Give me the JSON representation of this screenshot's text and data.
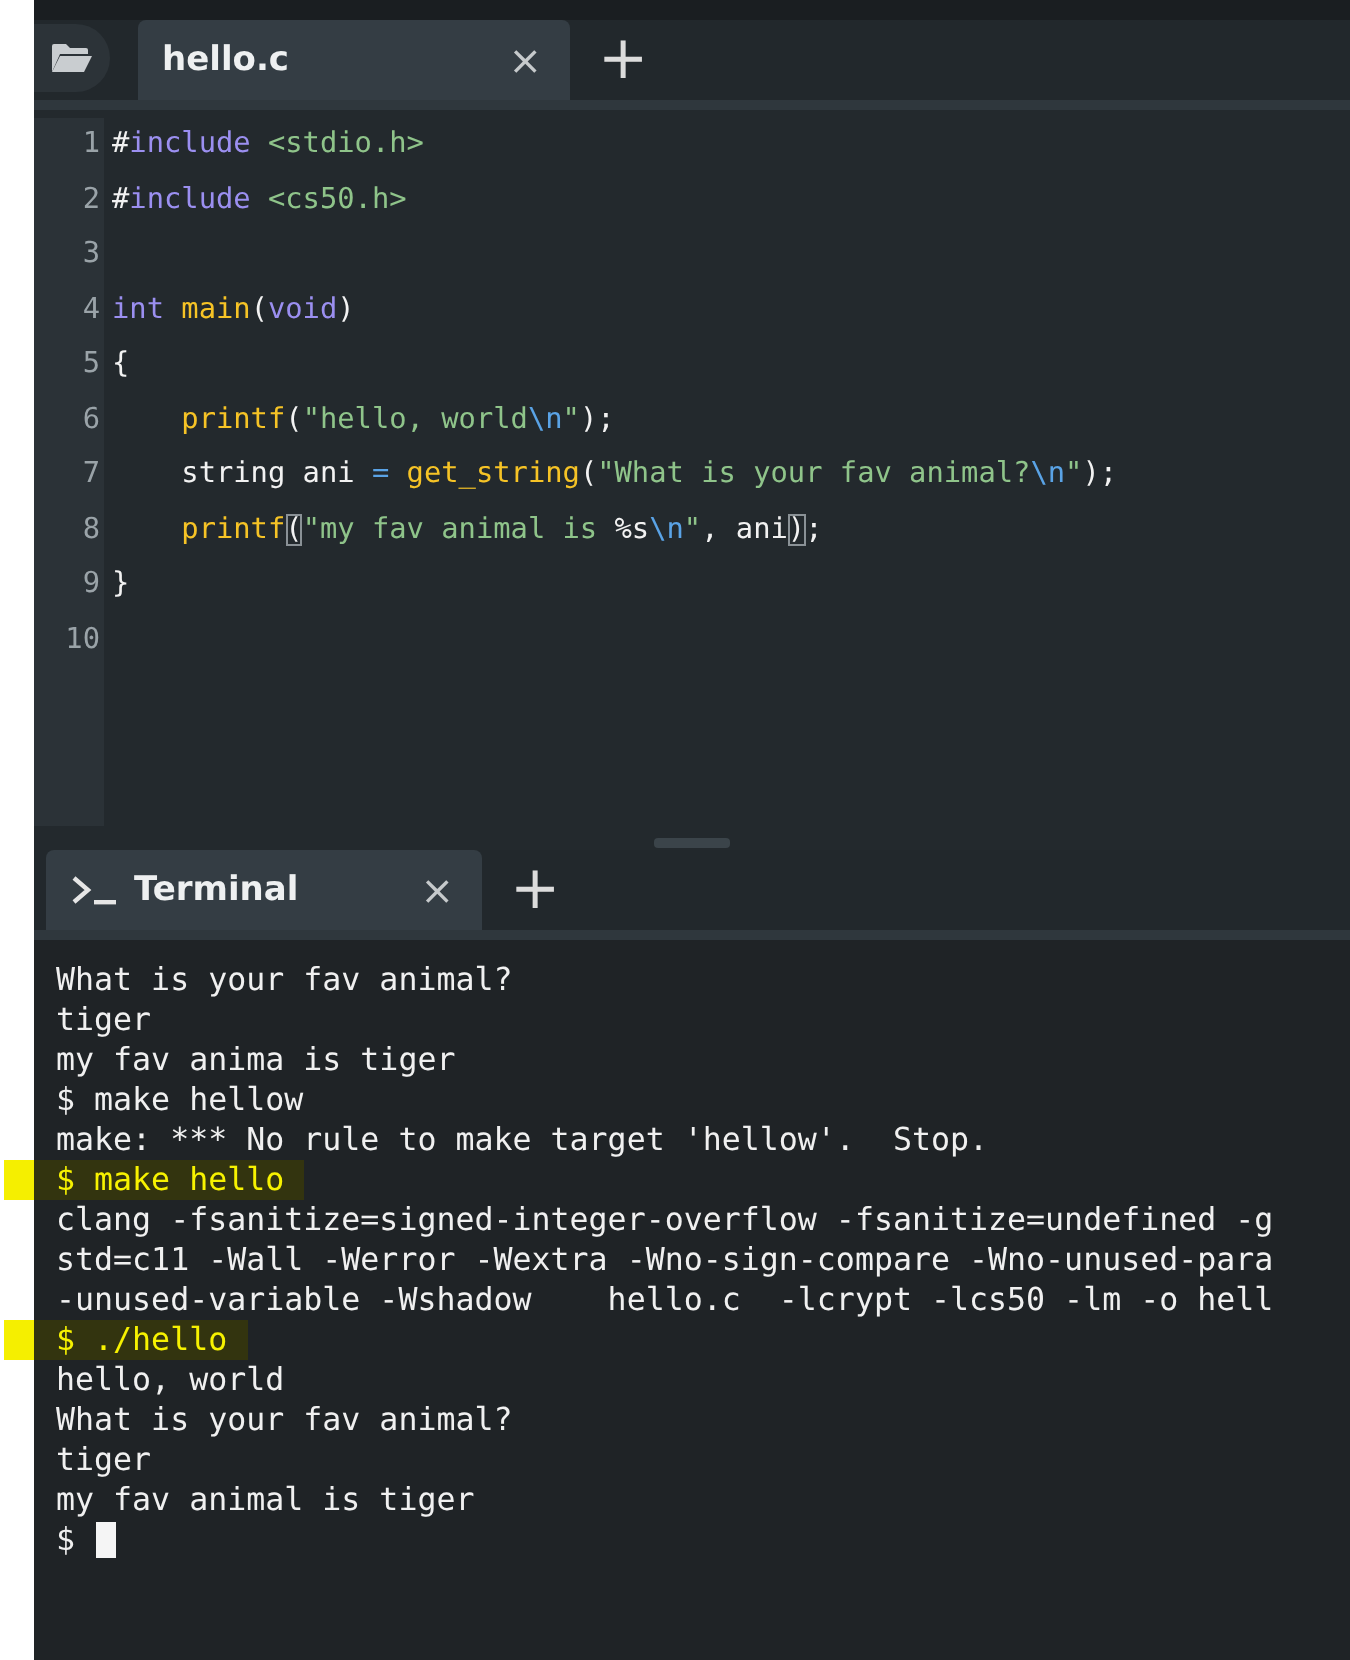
{
  "editor": {
    "tabs": [
      {
        "label": "hello.c",
        "selected": true,
        "close": "×"
      }
    ],
    "add_tab": "+",
    "lines": [
      {
        "number": "1",
        "tokens": [
          {
            "kind": "plain",
            "text": "#"
          },
          {
            "kind": "keyword",
            "text": "include "
          },
          {
            "kind": "string",
            "text": "<stdio.h>"
          }
        ]
      },
      {
        "number": "2",
        "tokens": [
          {
            "kind": "plain",
            "text": "#"
          },
          {
            "kind": "keyword",
            "text": "include "
          },
          {
            "kind": "string",
            "text": "<cs50.h>"
          }
        ]
      },
      {
        "number": "3"
      },
      {
        "number": "4",
        "tokens": [
          {
            "kind": "keyword",
            "text": "int "
          },
          {
            "kind": "func",
            "text": "main"
          },
          {
            "kind": "plain",
            "text": "("
          },
          {
            "kind": "keyword",
            "text": "void"
          },
          {
            "kind": "plain",
            "text": ")"
          }
        ]
      },
      {
        "number": "5",
        "tokens": [
          {
            "kind": "plain",
            "text": "{"
          }
        ]
      },
      {
        "number": "6",
        "tokens": [
          {
            "kind": "func",
            "text": "    printf"
          },
          {
            "kind": "plain",
            "text": "("
          },
          {
            "kind": "string",
            "text": "\"hello, world"
          },
          {
            "kind": "escape",
            "text": "\\n"
          },
          {
            "kind": "string",
            "text": "\""
          },
          {
            "kind": "plain",
            "text": ");"
          }
        ]
      },
      {
        "number": "7",
        "tokens": [
          {
            "kind": "plain",
            "text": "    string ani "
          },
          {
            "kind": "escape",
            "text": "= "
          },
          {
            "kind": "func",
            "text": "get_string"
          },
          {
            "kind": "plain",
            "text": "("
          },
          {
            "kind": "string",
            "text": "\"What is your fav animal?"
          },
          {
            "kind": "escape",
            "text": "\\n"
          },
          {
            "kind": "string",
            "text": "\""
          },
          {
            "kind": "plain",
            "text": ");"
          }
        ]
      },
      {
        "number": "8",
        "tokens": [
          {
            "kind": "func",
            "text": "    printf"
          },
          {
            "kind": "bracket",
            "text": "("
          },
          {
            "kind": "string",
            "text": "\"my fav animal is "
          },
          {
            "kind": "plain",
            "text": "%s"
          },
          {
            "kind": "escape",
            "text": "\\n"
          },
          {
            "kind": "string",
            "text": "\""
          },
          {
            "kind": "plain",
            "text": ", ani"
          },
          {
            "kind": "bracket",
            "text": ")"
          },
          {
            "kind": "plain",
            "text": ";"
          }
        ]
      },
      {
        "number": "9",
        "tokens": [
          {
            "kind": "plain",
            "text": "}"
          }
        ]
      },
      {
        "number": "10"
      }
    ]
  },
  "terminal": {
    "tabs": [
      {
        "label": "Terminal",
        "selected": true,
        "close": "×"
      }
    ],
    "add_tab": "+",
    "cursor": true,
    "lines": [
      {
        "text": "What is your fav animal?",
        "highlighted": false
      },
      {
        "text": "tiger",
        "highlighted": false
      },
      {
        "text": "my fav anima is tiger",
        "highlighted": false
      },
      {
        "text": "$ make hellow",
        "highlighted": false
      },
      {
        "text": "make: *** No rule to make target 'hellow'.  Stop.",
        "highlighted": false
      },
      {
        "text": "$ make hello",
        "highlighted": true
      },
      {
        "text": "clang -fsanitize=signed-integer-overflow -fsanitize=undefined -g",
        "highlighted": false
      },
      {
        "text": "std=c11 -Wall -Werror -Wextra -Wno-sign-compare -Wno-unused-para",
        "highlighted": false
      },
      {
        "text": "-unused-variable -Wshadow    hello.c  -lcrypt -lcs50 -lm -o hell",
        "highlighted": false
      },
      {
        "text": "$ ./hello",
        "highlighted": true
      },
      {
        "text": "hello, world",
        "highlighted": false
      },
      {
        "text": "What is your fav animal?",
        "highlighted": false
      },
      {
        "text": "tiger",
        "highlighted": false
      },
      {
        "text": "my fav animal is tiger",
        "highlighted": false
      },
      {
        "text": "$",
        "highlighted": false
      }
    ]
  }
}
